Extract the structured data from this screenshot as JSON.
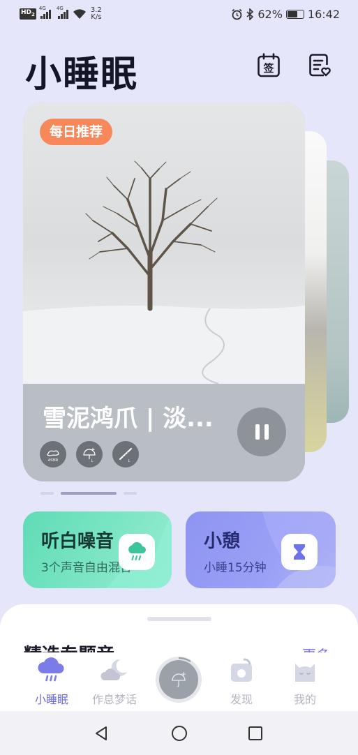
{
  "status": {
    "hd_label": "HD",
    "hd_sub": "2",
    "net1": "4G",
    "net2": "4G",
    "speed_value": "3.2",
    "speed_unit": "K/s",
    "battery": "62%",
    "time": "16:42"
  },
  "header": {
    "title": "小睡眠",
    "checkin_icon_label": "签"
  },
  "carousel": {
    "badge": "每日推荐",
    "title": "雪泥鸿爪 | 淡...",
    "tag_icons": [
      "asmr-icon",
      "snow-umbrella-icon",
      "flute-icon"
    ],
    "tag_labels": [
      "ASMR",
      "L",
      "L"
    ],
    "page_count": 3,
    "active_page": 2
  },
  "features": {
    "noise": {
      "title": "听白噪音",
      "subtitle": "3个声音自由混合",
      "icon": "rain-cloud-icon"
    },
    "nap": {
      "title": "小憩",
      "subtitle": "小睡15分钟",
      "icon": "hourglass-icon"
    }
  },
  "section": {
    "title": "精选专题音",
    "more": "更多"
  },
  "tabs": [
    {
      "label": "小睡眠",
      "icon": "rain-cloud-icon",
      "active": true
    },
    {
      "label": "作息梦话",
      "icon": "moon-cloud-icon",
      "active": false
    },
    {
      "label": "",
      "icon": "now-playing-icon",
      "active": false
    },
    {
      "label": "发现",
      "icon": "discover-icon",
      "active": false
    },
    {
      "label": "我的",
      "icon": "cat-icon",
      "active": false
    }
  ],
  "colors": {
    "background": "#e6e6fb",
    "accent": "#6b6bdf",
    "daily_badge": "#f6885a",
    "noise_card": "#5fdcb5",
    "nap_card": "#8e95f2"
  }
}
